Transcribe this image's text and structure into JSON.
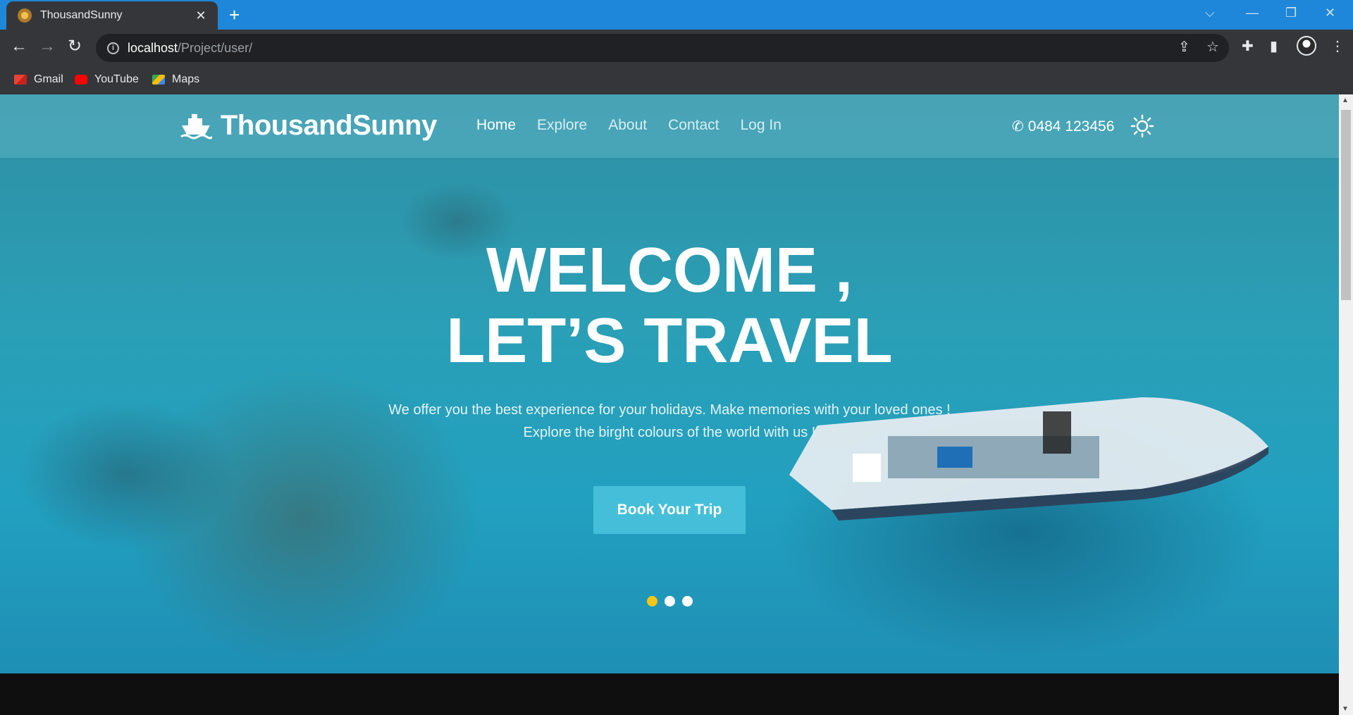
{
  "browser": {
    "tab_title": "ThousandSunny",
    "url_host": "localhost",
    "url_path": "/Project/user/",
    "bookmarks": [
      "Gmail",
      "YouTube",
      "Maps"
    ]
  },
  "site": {
    "brand": "ThousandSunny",
    "nav": [
      "Home",
      "Explore",
      "About",
      "Contact",
      "Log In"
    ],
    "phone": "0484 123456"
  },
  "hero": {
    "headline_line1": "WELCOME ,",
    "headline_line2": "LET’S TRAVEL",
    "sub_line1": "We offer you the best experience for your holidays. Make memories with your loved ones !",
    "sub_line2": "Explore the birght colours of the world with us !",
    "cta": "Book Your Trip",
    "slides_count": 3,
    "active_slide": 1
  },
  "colors": {
    "tabbar": "#1f87d9",
    "accent_button": "#45bfd9",
    "active_dot": "#f5c518"
  }
}
